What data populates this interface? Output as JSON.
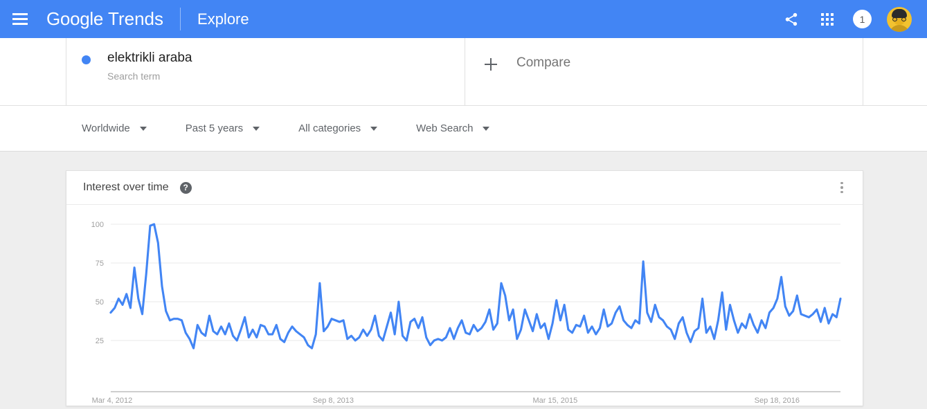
{
  "header": {
    "menu_icon": "hamburger-menu-icon",
    "brand_primary": "Google",
    "brand_secondary": "Trends",
    "nav_explore": "Explore",
    "share_icon": "share-icon",
    "apps_icon": "apps-grid-icon",
    "notification_count": "1",
    "avatar_icon": "user-avatar",
    "background_color": "#4285f4"
  },
  "terms": {
    "items": [
      {
        "name": "elektrikli araba",
        "subtitle": "Search term",
        "dot_color": "#4285f4"
      }
    ],
    "compare": {
      "plus_icon": "plus-icon",
      "label": "Compare"
    }
  },
  "filters": [
    {
      "label": "Worldwide",
      "caret_icon": "chevron-down-icon"
    },
    {
      "label": "Past 5 years",
      "caret_icon": "chevron-down-icon"
    },
    {
      "label": "All categories",
      "caret_icon": "chevron-down-icon"
    },
    {
      "label": "Web Search",
      "caret_icon": "chevron-down-icon"
    }
  ],
  "card": {
    "title": "Interest over time",
    "help_icon": "help-question-icon",
    "help_glyph": "?",
    "menu_icon": "more-options-kebab-icon"
  },
  "chart_data": {
    "type": "line",
    "title": "Interest over time",
    "xlabel": "",
    "ylabel": "",
    "ylim": [
      0,
      100
    ],
    "yticks": [
      25,
      50,
      75,
      100
    ],
    "xtick_labels": [
      "Mar 4, 2012",
      "Sep 8, 2013",
      "Mar 15, 2015",
      "Sep 18, 2016"
    ],
    "xtick_positions": [
      0,
      0.305,
      0.609,
      0.913
    ],
    "grid": true,
    "legend": false,
    "line_color": "#4285f4",
    "series": [
      {
        "name": "elektrikli araba",
        "values": [
          43,
          46,
          52,
          48,
          55,
          46,
          72,
          52,
          42,
          68,
          99,
          100,
          88,
          60,
          44,
          38,
          39,
          39,
          38,
          30,
          26,
          20,
          35,
          30,
          28,
          41,
          31,
          29,
          34,
          29,
          36,
          28,
          25,
          32,
          40,
          27,
          32,
          27,
          35,
          34,
          29,
          29,
          35,
          26,
          24,
          30,
          34,
          31,
          29,
          27,
          22,
          20,
          29,
          62,
          31,
          34,
          39,
          38,
          37,
          38,
          26,
          28,
          25,
          27,
          32,
          28,
          32,
          41,
          28,
          25,
          34,
          43,
          29,
          50,
          28,
          25,
          37,
          39,
          33,
          40,
          27,
          22,
          25,
          26,
          25,
          27,
          33,
          26,
          33,
          38,
          30,
          29,
          35,
          31,
          33,
          37,
          45,
          32,
          36,
          62,
          54,
          38,
          45,
          26,
          32,
          45,
          38,
          31,
          42,
          33,
          36,
          26,
          36,
          51,
          38,
          48,
          32,
          30,
          35,
          34,
          41,
          30,
          34,
          29,
          33,
          45,
          34,
          36,
          43,
          47,
          38,
          35,
          33,
          38,
          36,
          76,
          43,
          37,
          48,
          40,
          38,
          34,
          32,
          26,
          36,
          40,
          30,
          24,
          31,
          33,
          52,
          30,
          34,
          26,
          38,
          56,
          32,
          48,
          38,
          30,
          36,
          33,
          42,
          35,
          30,
          38,
          33,
          43,
          46,
          52,
          66,
          47,
          41,
          44,
          54,
          42,
          41,
          40,
          42,
          45,
          37,
          46,
          36,
          42,
          40,
          52
        ]
      }
    ]
  }
}
